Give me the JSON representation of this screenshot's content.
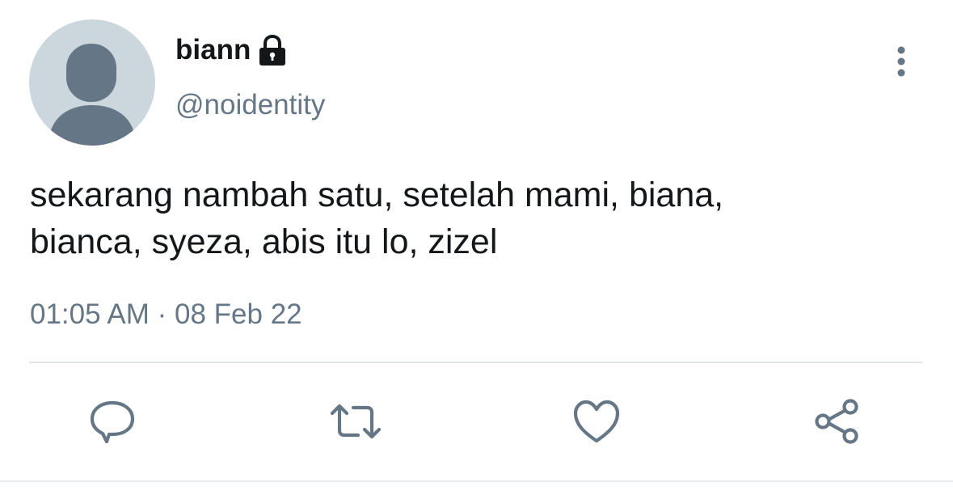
{
  "user": {
    "display_name": "biann",
    "handle": "@noidentity",
    "protected_icon": "lock-icon",
    "avatar_icon": "default-avatar-icon"
  },
  "tweet": {
    "text": "sekarang nambah satu, setelah mami, biana,\nbianca, syeza, abis itu lo, zizel",
    "time": "01:05 AM",
    "separator": "·",
    "date": "08 Feb 22"
  },
  "actions": {
    "reply_icon": "reply-icon",
    "retweet_icon": "retweet-icon",
    "like_icon": "heart-icon",
    "share_icon": "share-icon",
    "more_icon": "more-vertical-icon"
  },
  "colors": {
    "text": "#14171a",
    "secondary": "#657786",
    "avatar_bg": "#ccd6dd",
    "avatar_fg": "#657786",
    "divider": "#e1e8ed"
  }
}
